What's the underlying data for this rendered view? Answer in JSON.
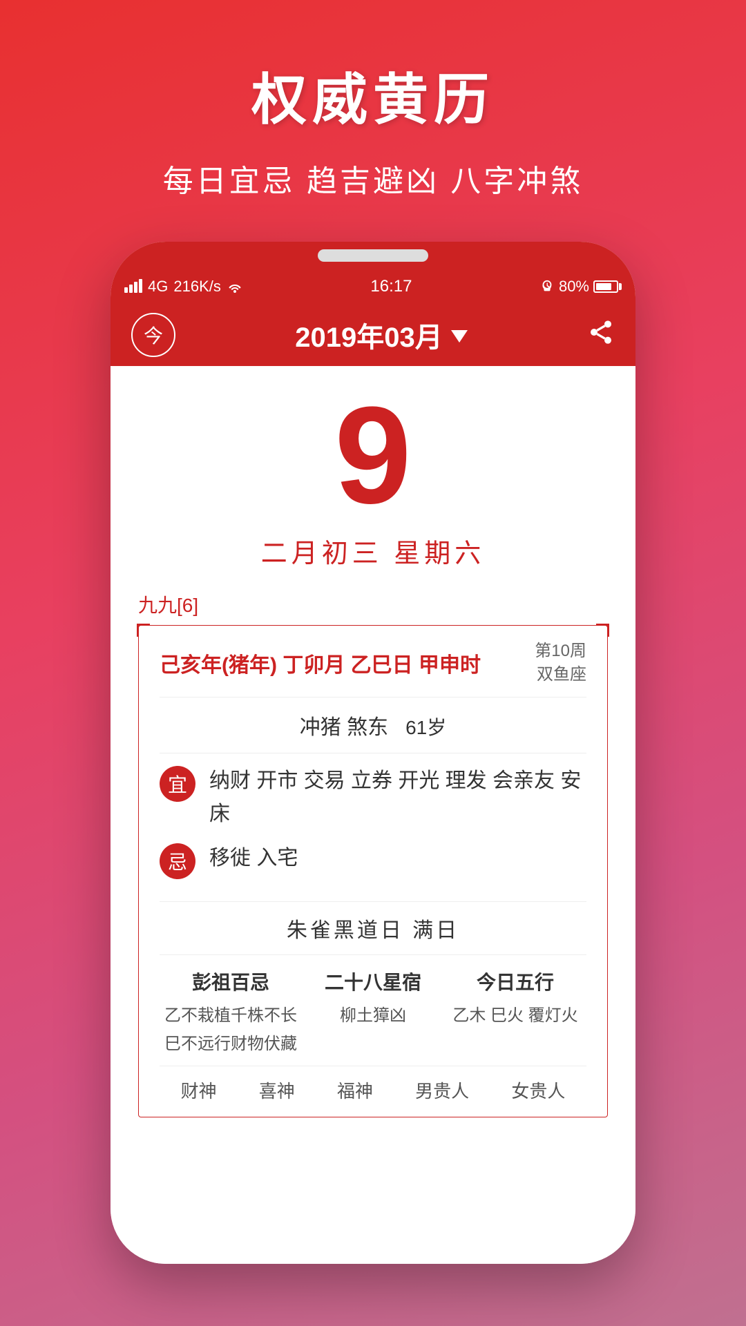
{
  "app": {
    "title": "权威黄历",
    "subtitle": "每日宜忌 趋吉避凶 八字冲煞"
  },
  "status_bar": {
    "signal": "4G",
    "speed": "216K/s",
    "wifi": "WiFi",
    "time": "16:17",
    "alarm": "🔔",
    "battery_pct": "80%"
  },
  "header": {
    "today_label": "今",
    "month_label": "2019年03月",
    "dropdown": "▼"
  },
  "calendar": {
    "day_number": "9",
    "lunar_date": "二月初三  星期六",
    "nine_nine": "九九[6]",
    "ganzhi": "己亥年(猪年) 丁卯月  乙巳日  甲申时",
    "week": "第10周",
    "zodiac": "双鱼座",
    "chong": "冲猪  煞东",
    "age": "61岁",
    "yi_label": "宜",
    "yi_content": "纳财 开市 交易 立券 开光 理发 会亲友 安床",
    "ji_label": "忌",
    "ji_content": "移徙 入宅",
    "black_day": "朱雀黑道日  满日",
    "col1_title": "彭祖百忌",
    "col1_content": "乙不栽植千株不长\n巳不远行财物伏藏",
    "col2_title": "二十八星宿",
    "col2_content": "柳土獐凶",
    "col3_title": "今日五行",
    "col3_content": "乙木 巳火 覆灯火",
    "bottom_labels": [
      "财神",
      "喜神",
      "福神",
      "男贵人",
      "女贵人"
    ]
  },
  "colors": {
    "primary_red": "#cc2222",
    "bg_gradient_start": "#e83030",
    "bg_gradient_end": "#c07090"
  }
}
